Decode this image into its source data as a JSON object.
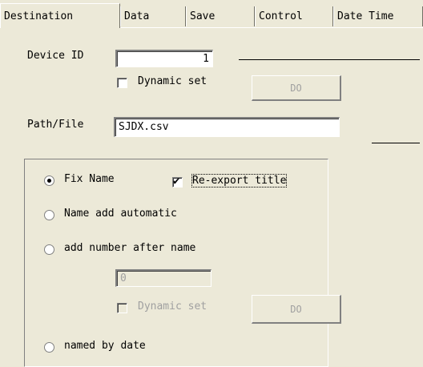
{
  "tabs": [
    "Destination",
    "Data",
    "Save",
    "Control",
    "Date Time"
  ],
  "device_id": {
    "label": "Device ID",
    "value": "1"
  },
  "dynamic_set": {
    "label": "Dynamic set",
    "checked": false
  },
  "do_button": "DO",
  "path_file": {
    "label": "Path/File",
    "value": "SJDX.csv"
  },
  "naming": {
    "fix_name": "Fix Name",
    "re_export": "Re-export title",
    "name_add_automatic": "Name add automatic",
    "add_number": "add number after name",
    "number_value": "0",
    "dynamic_set": "Dynamic set",
    "do_button": "DO",
    "named_by_date": "named by date",
    "selected": "fix_name",
    "re_export_checked": true
  },
  "colors": {
    "face": "#ece9d8",
    "shadow": "#808080",
    "disabled_text": "#a0a0a0"
  }
}
